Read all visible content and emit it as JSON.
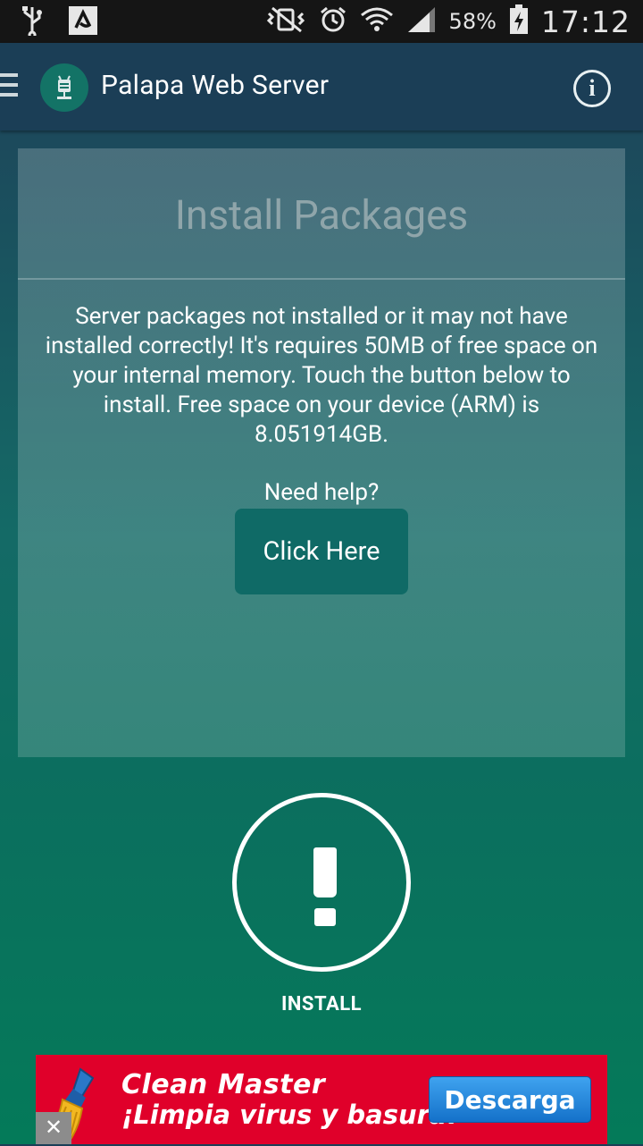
{
  "status_bar": {
    "battery": "58%",
    "time": "17:12",
    "icons": [
      "usb-icon",
      "avast-icon",
      "vibrate-mute-icon",
      "alarm-icon",
      "wifi-icon",
      "signal-icon",
      "battery-icon"
    ]
  },
  "app_bar": {
    "title": "Palapa Web Server",
    "info_icon": "info-icon",
    "menu_icon": "hamburger-icon",
    "logo_icon": "android-server-icon"
  },
  "card": {
    "title": "Install Packages",
    "message": "Server packages not installed or it may not have installed correctly! It's requires 50MB of free space on your internal memory. Touch the button below to install. Free space on your device (ARM) is 8.051914GB.",
    "help_text": "Need help?",
    "help_button": "Click Here"
  },
  "install": {
    "label": "INSTALL",
    "icon": "exclamation-icon"
  },
  "ad": {
    "title": "Clean Master",
    "subtitle": "¡Limpia virus y basura!",
    "cta": "Descarga",
    "close": "✕",
    "colors": {
      "background": "#e0002a",
      "cta": "#1f86de"
    }
  },
  "colors": {
    "accent": "#0f6a66",
    "app_bar": "#1b3e56"
  }
}
